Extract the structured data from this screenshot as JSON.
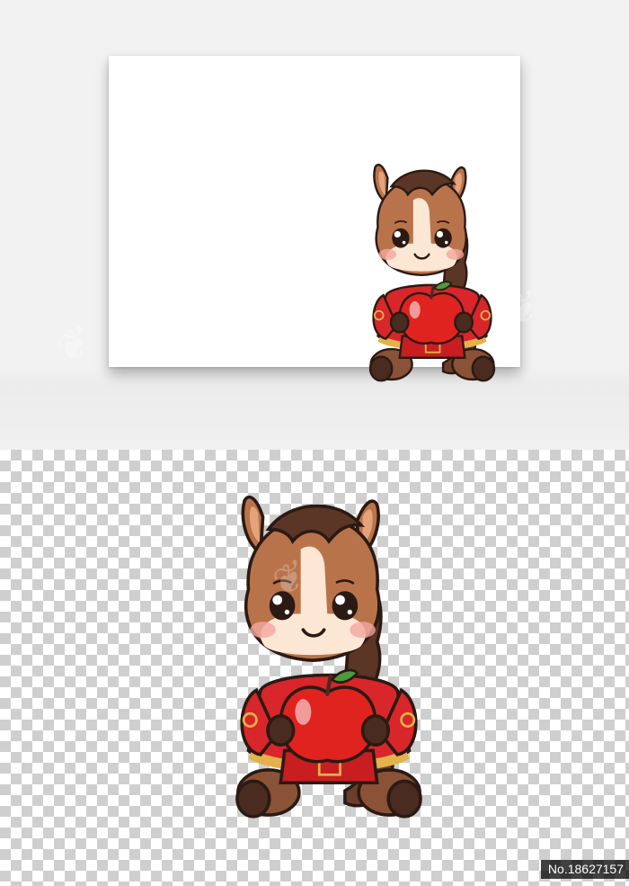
{
  "image_id_label": "No.18627157",
  "colors": {
    "fur": "#b9734a",
    "mane": "#5b3526",
    "face_patch": "#fbe7d3",
    "robe_red": "#d8262a",
    "robe_gold": "#e3b24a",
    "apple_red": "#e0231f",
    "leaf": "#4c9a3a"
  },
  "icons": [
    "cartoon-pony-holding-apple-illustration"
  ]
}
